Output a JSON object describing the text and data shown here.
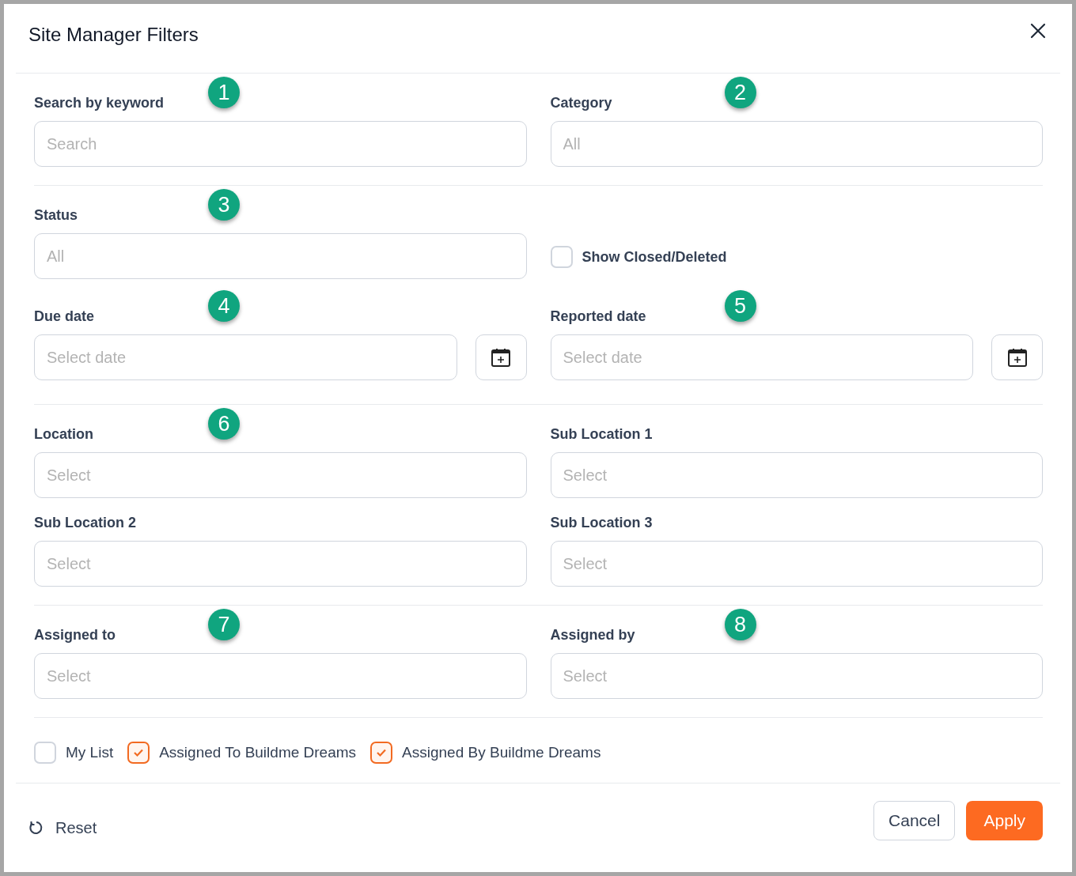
{
  "dialog": {
    "title": "Site Manager Filters",
    "sections": [
      {
        "fields": [
          {
            "kind": "input",
            "label": "Search by keyword",
            "placeholder": "Search",
            "callout": "1"
          },
          {
            "kind": "input",
            "label": "Category",
            "placeholder": "All",
            "callout": "2"
          }
        ]
      },
      {
        "fields": [
          {
            "kind": "input",
            "label": "Status",
            "placeholder": "All",
            "callout": "3"
          },
          {
            "kind": "checkbox",
            "label": "Show Closed/Deleted",
            "checked": false
          }
        ]
      },
      {
        "fields": [
          {
            "kind": "date",
            "label": "Due date",
            "placeholder": "Select date",
            "callout": "4"
          },
          {
            "kind": "date",
            "label": "Reported date",
            "placeholder": "Select date",
            "callout": "5"
          }
        ]
      },
      {
        "fields": [
          {
            "kind": "input",
            "label": "Location",
            "placeholder": "Select",
            "callout": "6"
          },
          {
            "kind": "input",
            "label": "Sub Location 1",
            "placeholder": "Select"
          },
          {
            "kind": "input",
            "label": "Sub Location 2",
            "placeholder": "Select"
          },
          {
            "kind": "input",
            "label": "Sub Location 3",
            "placeholder": "Select"
          }
        ]
      },
      {
        "fields": [
          {
            "kind": "input",
            "label": "Assigned to",
            "placeholder": "Select",
            "callout": "7"
          },
          {
            "kind": "input",
            "label": "Assigned by",
            "placeholder": "Select",
            "callout": "8"
          }
        ]
      }
    ],
    "options": [
      {
        "label": "My List",
        "checked": false
      },
      {
        "label": "Assigned To Buildme Dreams",
        "checked": true
      },
      {
        "label": "Assigned By Buildme Dreams",
        "checked": true
      }
    ],
    "footer": {
      "reset": "Reset",
      "cancel": "Cancel",
      "apply": "Apply"
    }
  }
}
